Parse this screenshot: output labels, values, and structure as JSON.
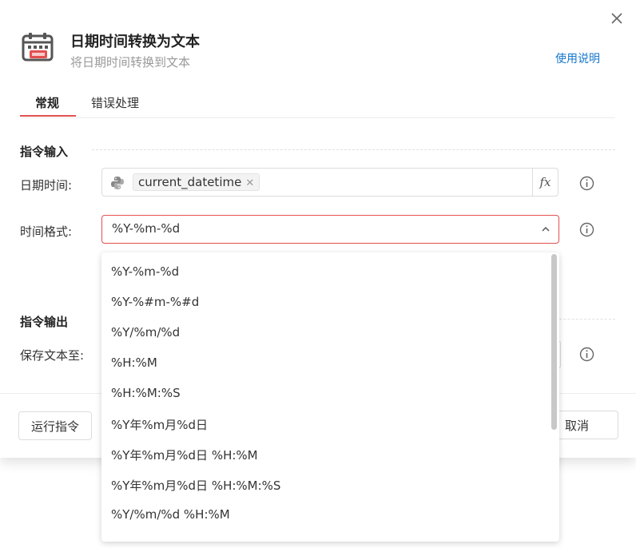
{
  "header": {
    "title": "日期时间转换为文本",
    "subtitle": "将日期时间转换到文本",
    "help_link": "使用说明"
  },
  "tabs": [
    {
      "label": "常规",
      "active": true
    },
    {
      "label": "错误处理",
      "active": false
    }
  ],
  "input_section": {
    "title": "指令输入",
    "datetime_label": "日期时间:",
    "datetime_tag": "current_datetime",
    "fx_label": "fx",
    "format_label": "时间格式:",
    "format_value": "%Y-%m-%d"
  },
  "output_section": {
    "title": "指令输出",
    "save_label": "保存文本至:"
  },
  "footer": {
    "run_label": "运行指令",
    "cancel_label": "取消"
  },
  "dropdown": {
    "options": [
      "%Y-%m-%d",
      "%Y-%#m-%#d",
      "%Y/%m/%d",
      "%H:%M",
      "%H:%M:%S",
      "%Y年%m月%d日",
      "%Y年%m月%d日 %H:%M",
      "%Y年%m月%d日 %H:%M:%S",
      "%Y/%m/%d %H:%M"
    ]
  },
  "colors": {
    "accent": "#e35050",
    "link": "#1677cc"
  }
}
